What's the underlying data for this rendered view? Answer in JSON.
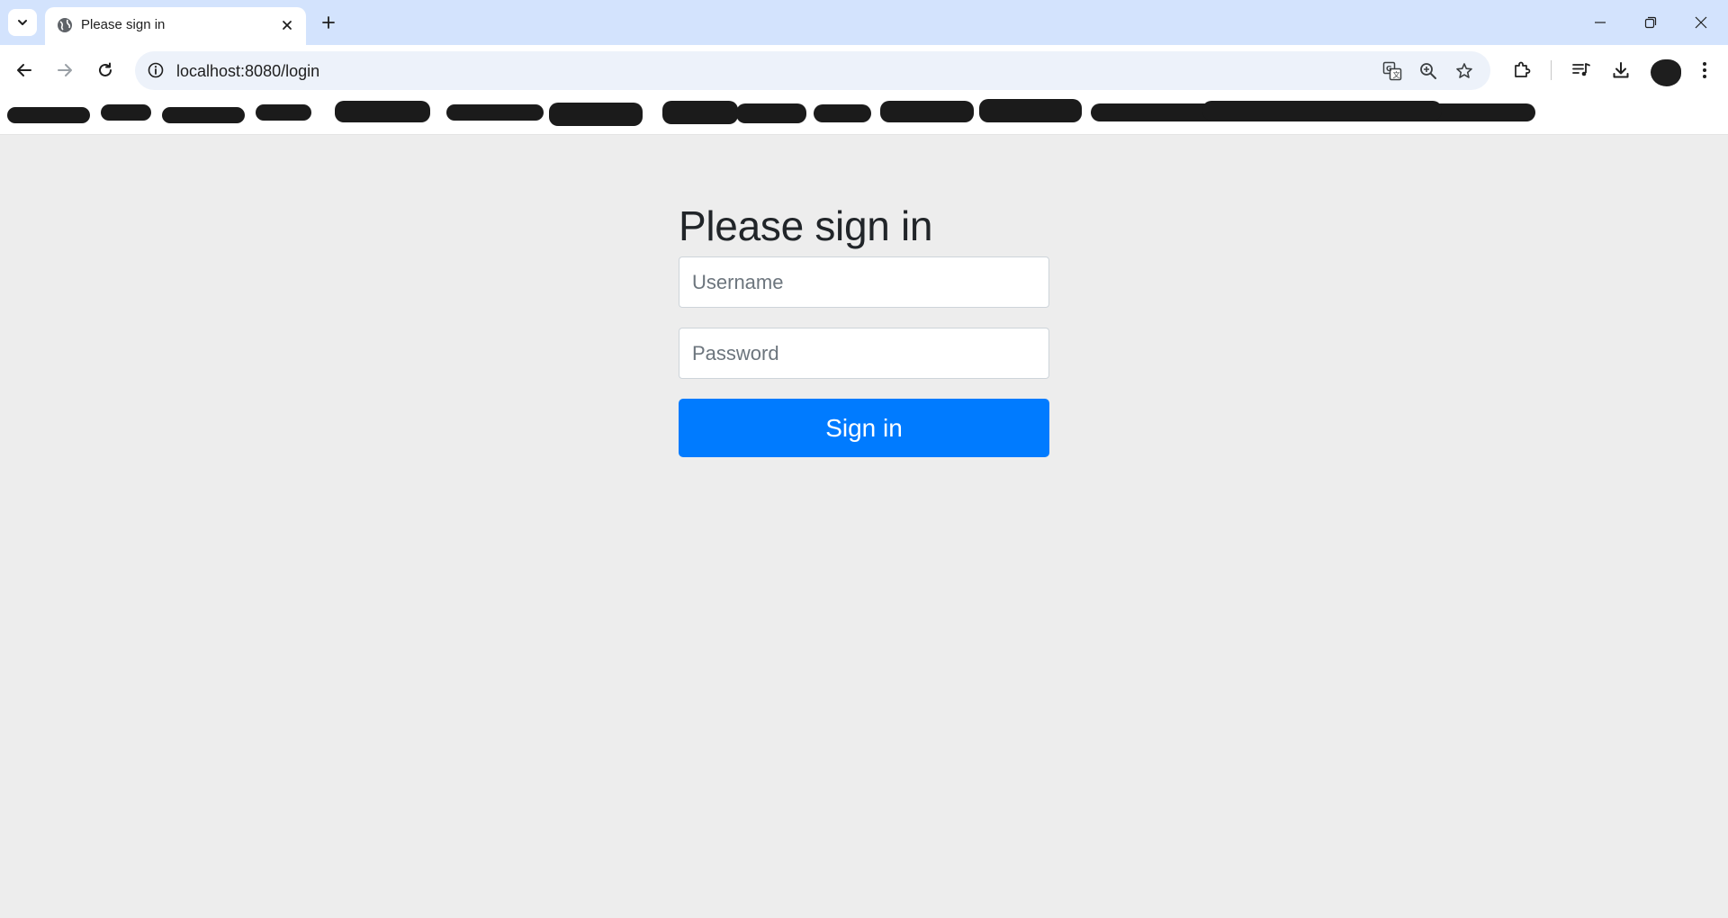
{
  "browser": {
    "tab": {
      "title": "Please sign in",
      "favicon_icon": "globe-icon",
      "close_icon": "close-icon"
    },
    "new_tab_icon": "plus-icon",
    "tab_search_icon": "chevron-down-icon",
    "window_controls": [
      "minimize-icon",
      "restore-icon",
      "close-icon"
    ],
    "toolbar": {
      "back_icon": "arrow-left-icon",
      "forward_icon": "arrow-right-icon",
      "reload_icon": "reload-icon",
      "site_info_icon": "info-icon",
      "url": "localhost:8080/login",
      "omnibox_icons": [
        "translate-icon",
        "zoom-icon",
        "star-icon"
      ],
      "right_icons": [
        "extensions-icon",
        "media-control-icon",
        "download-icon",
        "avatar",
        "more-icon"
      ]
    },
    "bookmarks_bar": {
      "note": ""
    }
  },
  "page": {
    "heading": "Please sign in",
    "username": {
      "placeholder": "Username",
      "value": ""
    },
    "password": {
      "placeholder": "Password",
      "value": ""
    },
    "submit_label": "Sign in"
  },
  "colors": {
    "tabstrip_bg": "#d3e3fd",
    "page_bg": "#ededed",
    "primary_button": "#007bff",
    "heading_text": "#212529"
  }
}
